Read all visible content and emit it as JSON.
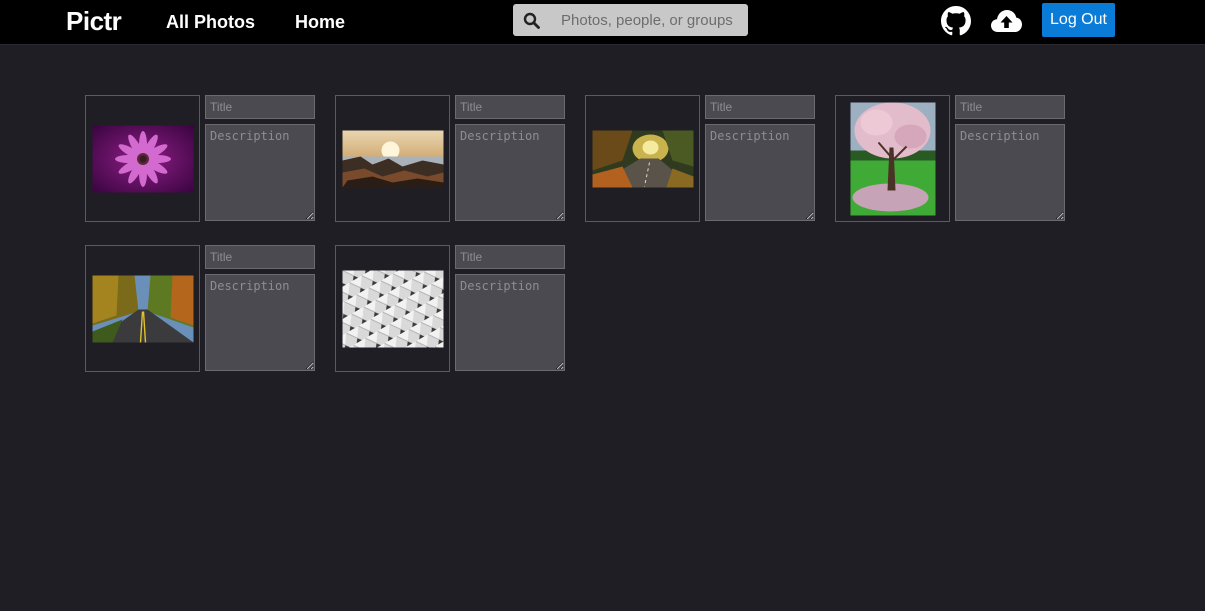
{
  "header": {
    "logo": "Pictr",
    "nav": [
      {
        "label": "All Photos"
      },
      {
        "label": "Home"
      }
    ],
    "search_placeholder": "Photos, people, or groups",
    "icons": [
      "search-icon",
      "github-icon",
      "cloud-upload-icon"
    ],
    "logout_label": "Log Out"
  },
  "colors": {
    "background": "#1f1e24",
    "topbar": "#000000",
    "accent": "#0a7bd6",
    "field_bg": "#4a4a50"
  },
  "photos": [
    {
      "image": "purple-daisy-photo",
      "title_placeholder": "Title",
      "description_placeholder": "Description"
    },
    {
      "image": "rocky-coast-sunset-photo",
      "title_placeholder": "Title",
      "description_placeholder": "Description"
    },
    {
      "image": "autumn-road-photo",
      "title_placeholder": "Title",
      "description_placeholder": "Description"
    },
    {
      "image": "cherry-blossom-tree-photo",
      "title_placeholder": "Title",
      "description_placeholder": "Description"
    },
    {
      "image": "forest-highway-photo",
      "title_placeholder": "Title",
      "description_placeholder": "Description"
    },
    {
      "image": "white-geometric-facade-photo",
      "title_placeholder": "Title",
      "description_placeholder": "Description"
    }
  ]
}
